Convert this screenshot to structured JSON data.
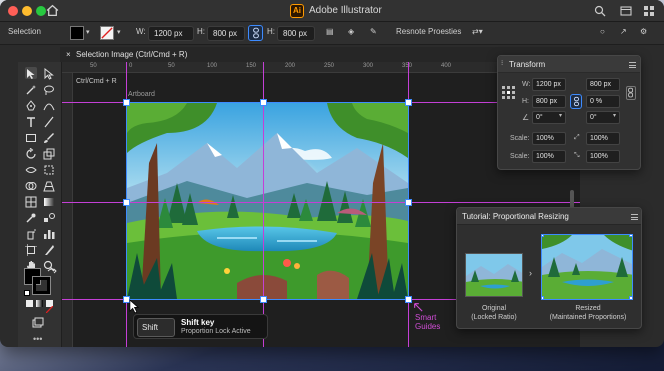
{
  "titlebar": {
    "app_logo": "Ai",
    "title": "Adobe Illustrator",
    "traffic_colors": [
      "#ff5f57",
      "#febc2e",
      "#28c840"
    ],
    "icons": [
      "home-icon",
      "search-icon",
      "window-icon",
      "grid-icon",
      "settings-icon"
    ]
  },
  "control_bar": {
    "mode_label": "Selection",
    "fill_color": "#000000",
    "w_label": "W:",
    "w_value": "1200 px",
    "h_label": "H:",
    "h_value": "800 px",
    "h2_label": "H:",
    "h2_value": "800 px",
    "properties_button": "Resnote Proesties"
  },
  "document": {
    "tab_label": "Selection Image (Ctrl/Cmd + R)",
    "crop_label": "Ctrl/Cmd + R",
    "artboard_label": "Artboard"
  },
  "rulers": {
    "h_ticks": [
      "50",
      "0",
      "50",
      "100",
      "150",
      "200",
      "250",
      "300",
      "350",
      "400"
    ]
  },
  "tooltip": {
    "key": "Shift",
    "title": "Shift key",
    "subtitle": "Proportion Lock Active"
  },
  "smart_guides": {
    "line1": "Smart",
    "line2": "Guides",
    "color": "#d04dd6"
  },
  "transform_panel": {
    "title": "Transform",
    "w_label": "W:",
    "w_value": "1200 px",
    "w2_value": "800 px",
    "h_label": "H:",
    "h_value": "800 px",
    "h_percent": "0 %",
    "angle_value": "0°",
    "shear_value": "0°",
    "scale_label": "Scale:",
    "scale1_value": "100%",
    "scale1b_value": "100%",
    "scale2_label": "Scale:",
    "scale2_value": "100%",
    "scale2b_value": "100%"
  },
  "tutorial_panel": {
    "title": "Tutorial: Proportional Resizing",
    "original_line1": "Original",
    "original_line2": "(Locked Ratio)",
    "resized_line1": "Resized",
    "resized_line2": "(Maintained Proportions)"
  },
  "colors": {
    "accent": "#3d8bff",
    "guide": "#c43fd6",
    "brand": "#ff9a00"
  }
}
